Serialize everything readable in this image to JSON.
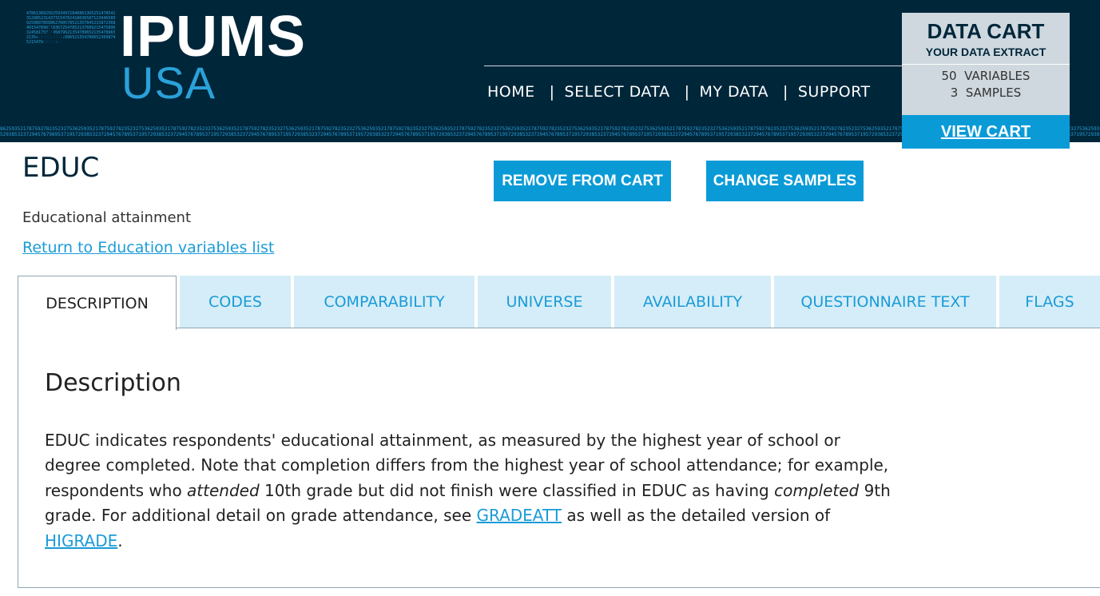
{
  "header": {
    "logo_primary": "IPUMS",
    "logo_secondary": "USA",
    "nav": [
      {
        "label": "HOME"
      },
      {
        "label": "SELECT DATA"
      },
      {
        "label": "MY DATA"
      },
      {
        "label": "SUPPORT"
      }
    ],
    "nav_separator": "|"
  },
  "cart": {
    "title": "DATA CART",
    "subtitle": "YOUR DATA EXTRACT",
    "variables_line": "50  VARIABLES",
    "samples_line": "3  SAMPLES",
    "view_button": "VIEW CART"
  },
  "variable": {
    "name": "EDUC",
    "label": "Educational attainment",
    "return_link": "Return to Education variables list"
  },
  "actions": {
    "remove": "REMOVE FROM CART",
    "change": "CHANGE SAMPLES"
  },
  "tabs": [
    {
      "label": "DESCRIPTION",
      "active": true
    },
    {
      "label": "CODES",
      "active": false
    },
    {
      "label": "COMPARABILITY",
      "active": false
    },
    {
      "label": "UNIVERSE",
      "active": false
    },
    {
      "label": "AVAILABILITY",
      "active": false
    },
    {
      "label": "QUESTIONNAIRE TEXT",
      "active": false
    },
    {
      "label": "FLAGS",
      "active": false
    }
  ],
  "description": {
    "heading": "Description",
    "text_1": "EDUC indicates respondents' educational attainment, as measured by the highest year of school or degree completed. Note that completion differs from the highest year of school attendance; for example, respondents who ",
    "em_1": "attended",
    "text_2": " 10th grade but did not finish were classified in EDUC as having ",
    "em_2": "completed",
    "text_3": " 9th grade. For additional detail on grade attendance, see ",
    "link_1": "GRADEATT",
    "text_4": " as well as the detailed version of ",
    "link_2": "HIGRADE",
    "text_5": "."
  },
  "colors": {
    "header_bg": "#00263a",
    "accent": "#0a9bd7",
    "tab_bg": "#d5edf8",
    "cart_bg": "#ced8de"
  }
}
